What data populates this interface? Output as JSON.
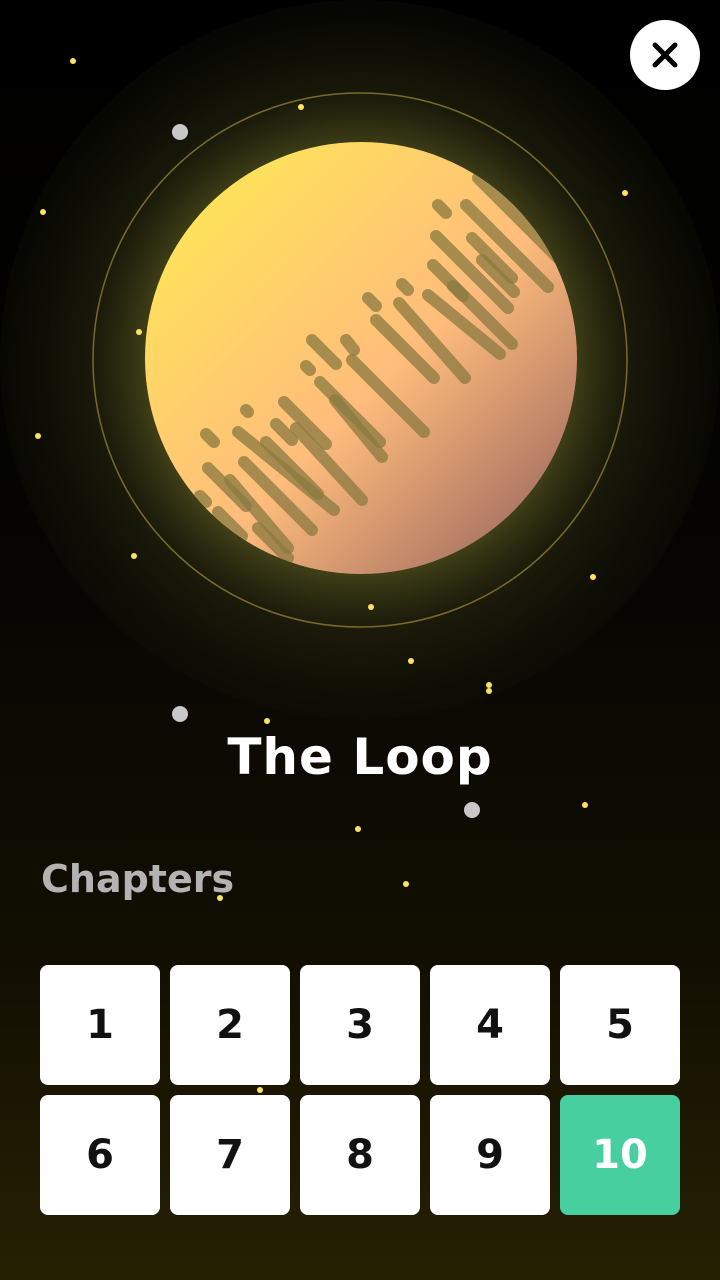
{
  "title": "The Loop",
  "chapters_label": "Chapters",
  "chapters": [
    {
      "label": "1",
      "active": false
    },
    {
      "label": "2",
      "active": false
    },
    {
      "label": "3",
      "active": false
    },
    {
      "label": "4",
      "active": false
    },
    {
      "label": "5",
      "active": false
    },
    {
      "label": "6",
      "active": false
    },
    {
      "label": "7",
      "active": false
    },
    {
      "label": "8",
      "active": false
    },
    {
      "label": "9",
      "active": false
    },
    {
      "label": "10",
      "active": true
    }
  ],
  "icons": {
    "close": "close-icon",
    "planet": "planet-illustration"
  },
  "colors": {
    "active_chapter": "#48cfa0",
    "planet_light": "#ffe45a",
    "planet_dark": "#a07060",
    "star": "#ffe45a",
    "moon": "#c8c8c8"
  }
}
